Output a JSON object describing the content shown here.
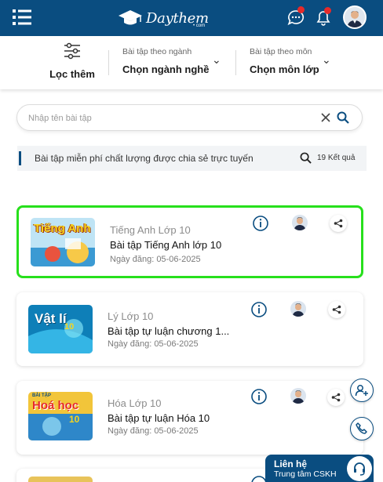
{
  "header": {
    "logo_text": "Daythem",
    "logo_sub": "• com",
    "colors": {
      "brand": "#0a4d80",
      "notification": "#e62a2a",
      "selected_border": "#27e01c"
    }
  },
  "filters": {
    "more_label": "Lọc thêm",
    "major": {
      "caption": "Bài tập theo ngành",
      "value": "Chọn ngành nghề"
    },
    "subject": {
      "caption": "Bài tập theo môn",
      "value": "Chọn môn lớp"
    }
  },
  "search": {
    "placeholder": "Nhập tên bài tập",
    "value": ""
  },
  "info": {
    "text": "Bài tập miễn phí chất lượng được chia sẻ trực tuyến",
    "result_count": "19 Kết quả"
  },
  "cards": [
    {
      "subject": "Tiếng Anh Lớp 10",
      "title": "Bài tập Tiếng Anh lớp 10",
      "date": "Ngày đăng: 05-06-2025",
      "thumb_label": "Tiếng Anh",
      "selected": true
    },
    {
      "subject": "Lý Lớp 10",
      "title": "Bài tập tự luận chương 1...",
      "date": "Ngày đăng: 05-06-2025",
      "thumb_label": "Vật lí",
      "thumb_num": "10"
    },
    {
      "subject": "Hóa Lớp 10",
      "title": "Bài tập tự luận Hóa 10",
      "date": "Ngày đăng: 05-06-2025",
      "thumb_label": "Hoá học",
      "thumb_top": "BÀI TẬP",
      "thumb_num": "10"
    }
  ],
  "support": {
    "title": "Liên hệ",
    "subtitle": "Trung tâm CSKH"
  }
}
